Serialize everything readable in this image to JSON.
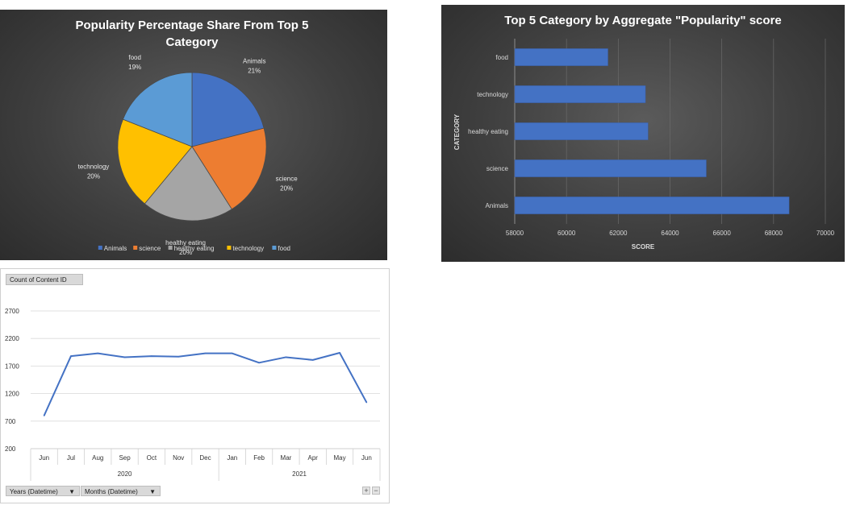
{
  "pie_chart": {
    "title_line1": "Popularity Percentage Share From Top 5",
    "title_line2": "Category"
  },
  "bar_chart": {
    "title": "Top 5  Category by Aggregate \"Popularity\" score",
    "xlabel": "SCORE",
    "ylabel": "CATEGORY"
  },
  "line_chart": {
    "field_button": "Count of Content ID",
    "years_button": "Years (Datetime)",
    "months_button": "Months (Datetime)",
    "plus": "+",
    "minus": "−"
  },
  "colors": {
    "animals": "#4472c4",
    "science": "#ed7d31",
    "healthy_eating": "#a5a5a5",
    "technology": "#ffc000",
    "food": "#5b9bd5",
    "line": "#4472c4"
  },
  "chart_data": [
    {
      "type": "pie",
      "title": "Popularity Percentage Share From Top 5 Category",
      "categories": [
        "Animals",
        "science",
        "healthy eating",
        "technology",
        "food"
      ],
      "values": [
        21,
        20,
        20,
        20,
        19
      ],
      "value_labels": [
        "21%",
        "20%",
        "20%",
        "20%",
        "19%"
      ],
      "legend_position": "bottom"
    },
    {
      "type": "bar",
      "orientation": "horizontal",
      "title": "Top 5  Category by Aggregate \"Popularity\" score",
      "categories": [
        "food",
        "technology",
        "healthy eating",
        "science",
        "Animals"
      ],
      "values": [
        61600,
        63050,
        63150,
        65400,
        68600
      ],
      "xlabel": "SCORE",
      "ylabel": "CATEGORY",
      "xlim": [
        58000,
        70000
      ],
      "xticks": [
        "58000",
        "60000",
        "62000",
        "64000",
        "66000",
        "68000",
        "70000"
      ],
      "grid": true
    },
    {
      "type": "line",
      "title": "",
      "x": [
        "Jun",
        "Jul",
        "Aug",
        "Sep",
        "Oct",
        "Nov",
        "Dec",
        "Jan",
        "Feb",
        "Mar",
        "Apr",
        "May",
        "Jun"
      ],
      "groups": [
        {
          "label": "2020",
          "months": 7
        },
        {
          "label": "2021",
          "months": 6
        }
      ],
      "series": [
        {
          "values": [
            800,
            1880,
            1930,
            1860,
            1880,
            1870,
            1930,
            1930,
            1760,
            1860,
            1810,
            1940,
            1040
          ]
        }
      ],
      "ylim": [
        200,
        2700
      ],
      "yticks": [
        "2700",
        "2200",
        "1700",
        "1200",
        "700",
        "200"
      ],
      "grid": true
    }
  ]
}
